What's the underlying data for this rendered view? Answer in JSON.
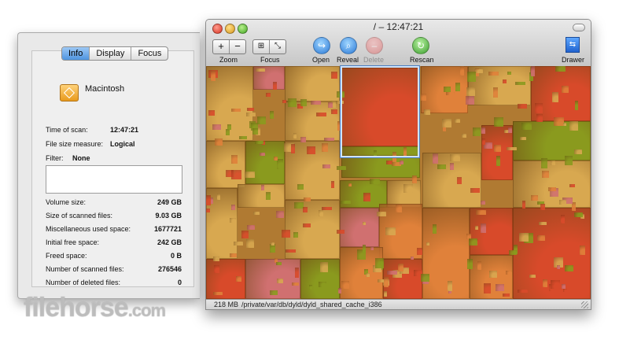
{
  "window": {
    "title": "/ – 12:47:21",
    "status_size": "218 MB",
    "status_path": "/private/var/db/dyld/dyld_shared_cache_i386"
  },
  "toolbar": {
    "zoom_in": "+",
    "zoom_out": "−",
    "zoom_label": "Zoom",
    "focus_label": "Focus",
    "open_label": "Open",
    "reveal_label": "Reveal",
    "delete_label": "Delete",
    "rescan_label": "Rescan",
    "drawer_label": "Drawer",
    "icons": [
      "zoom-in-icon",
      "zoom-out-icon",
      "focus-icon",
      "open-icon",
      "reveal-icon",
      "delete-icon",
      "rescan-icon",
      "drawer-icon"
    ]
  },
  "drawer": {
    "tabs": [
      {
        "label": "Info",
        "active": true
      },
      {
        "label": "Display",
        "active": false
      },
      {
        "label": "Focus",
        "active": false
      }
    ],
    "disk_name": "Macintosh",
    "time_of_scan_label": "Time of scan:",
    "time_of_scan": "12:47:21",
    "file_size_measure_label": "File size measure:",
    "file_size_measure": "Logical",
    "filter_label": "Filter:",
    "filter": "None",
    "stats": [
      {
        "label": "Volume size:",
        "value": "249 GB"
      },
      {
        "label": "Size of scanned files:",
        "value": "9.03 GB"
      },
      {
        "label": "Miscellaneous used space:",
        "value": "1677721"
      },
      {
        "label": "Initial free space:",
        "value": "242 GB"
      },
      {
        "label": "Freed space:",
        "value": "0 B"
      },
      {
        "label": "Number of scanned files:",
        "value": "276546"
      },
      {
        "label": "Number of deleted files:",
        "value": "0"
      }
    ]
  },
  "watermark": {
    "main": "filehorse",
    "suffix": ".com"
  },
  "colors": {
    "active_tab": "#4f94e0",
    "treemap_red": "#d84a2a",
    "treemap_orange": "#e0813a",
    "treemap_olive": "#8a9a1e",
    "treemap_gold": "#d8a850",
    "treemap_pink": "#d07070"
  }
}
